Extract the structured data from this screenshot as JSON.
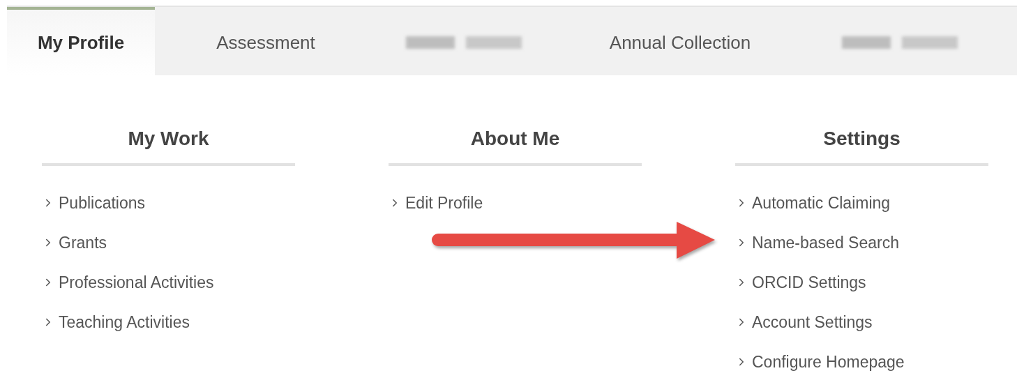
{
  "tabs": [
    {
      "kind": "text",
      "label": "My Profile",
      "selected": true
    },
    {
      "kind": "text",
      "label": "Assessment",
      "selected": false
    },
    {
      "kind": "redacted",
      "selected": false
    },
    {
      "kind": "text",
      "label": "Annual Collection",
      "selected": false
    },
    {
      "kind": "redacted",
      "selected": false
    }
  ],
  "columns": [
    {
      "heading": "My Work",
      "links": [
        "Publications",
        "Grants",
        "Professional Activities",
        "Teaching Activities"
      ]
    },
    {
      "heading": "About Me",
      "links": [
        "Edit Profile"
      ]
    },
    {
      "heading": "Settings",
      "links": [
        "Automatic Claiming",
        "Name-based Search",
        "ORCID Settings",
        "Account Settings",
        "Configure Homepage"
      ]
    }
  ]
}
